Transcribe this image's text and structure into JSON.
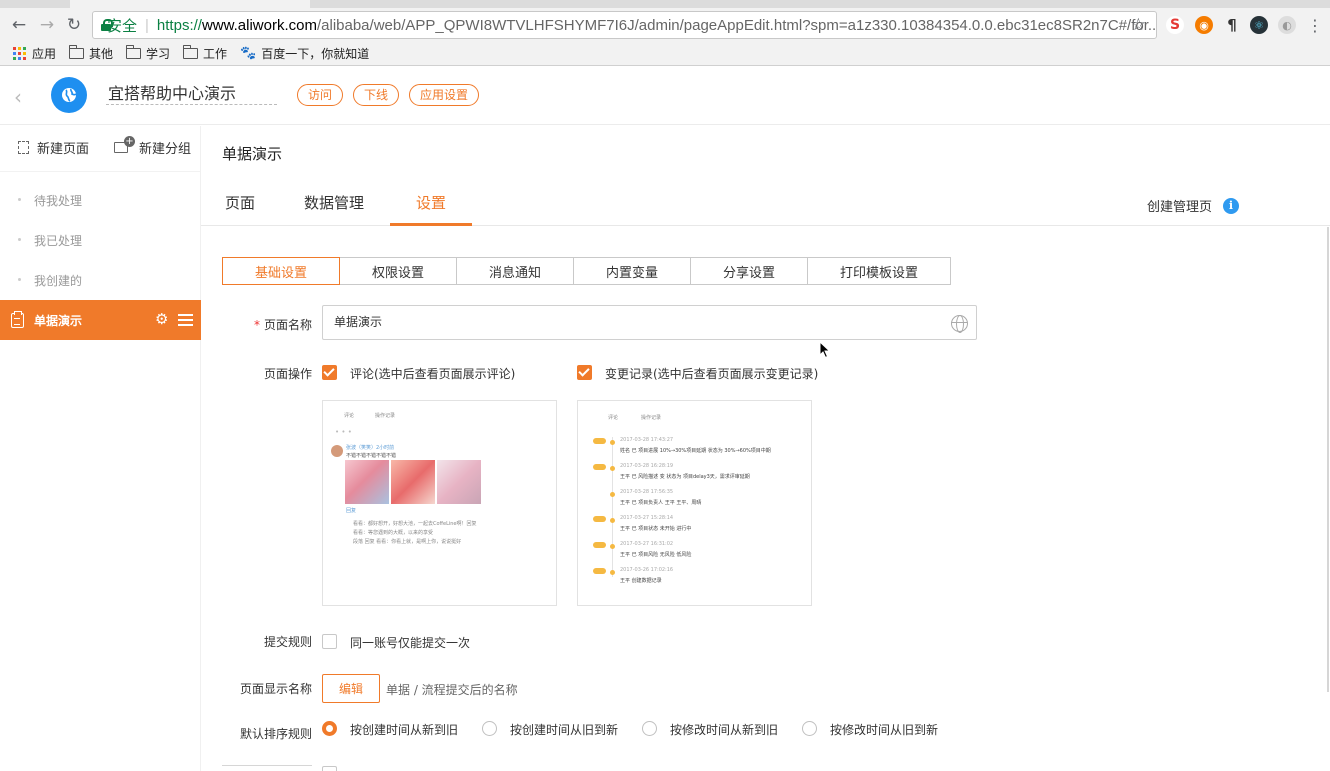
{
  "browser": {
    "secure_label": "安全",
    "url_proto": "https://",
    "url_host": "www.aliwork.com",
    "url_path": "/alibaba/web/APP_QPWI8WTVLHFSHYMF7I6J/admin/pageAppEdit.html?spm=a1z330.10384354.0.0.ebc31ec8SR2n7C#/for...",
    "bookmarks": [
      {
        "label": "应用",
        "icon": "apps-grid-icon"
      },
      {
        "label": "其他",
        "icon": "folder-icon"
      },
      {
        "label": "学习",
        "icon": "folder-icon"
      },
      {
        "label": "工作",
        "icon": "folder-icon"
      },
      {
        "label": "百度一下，你就知道",
        "icon": "baidu-paw-icon"
      }
    ]
  },
  "header": {
    "app_title": "宜搭帮助中心演示",
    "buttons": [
      "访问",
      "下线",
      "应用设置"
    ],
    "accent": "#f07a2a"
  },
  "sidebar": {
    "actions": [
      "新建页面",
      "新建分组"
    ],
    "items": [
      "待我处理",
      "我已处理",
      "我创建的"
    ],
    "active_item": "单据演示"
  },
  "main": {
    "page_heading": "单据演示",
    "tabs": [
      "页面",
      "数据管理",
      "设置"
    ],
    "active_tab": "设置",
    "create_mgmt": "创建管理页",
    "sub_tabs": [
      "基础设置",
      "权限设置",
      "消息通知",
      "内置变量",
      "分享设置",
      "打印模板设置"
    ],
    "active_sub_tab": "基础设置"
  },
  "form": {
    "page_name": {
      "label": "页面名称",
      "required": "*",
      "value": "单据演示"
    },
    "page_ops": {
      "label": "页面操作",
      "options": [
        {
          "text": "评论(选中后查看页面展示评论)",
          "checked": true
        },
        {
          "text": "变更记录(选中后查看页面展示变更记录)",
          "checked": true
        }
      ]
    },
    "preview_comment": {
      "tabs": [
        "评论",
        "操作记录"
      ],
      "user": "张波（笑笑）2小时前",
      "text": "不错不错不错不错不错",
      "reply_label": "回复",
      "lines": [
        "看看：都好想开，好想大池，一起去CoffeLine啊！回复",
        "看看：等您遇到的大概，以来的享受",
        "段落 回复 看看：你看上就，是啊上你，说说挺好"
      ]
    },
    "preview_log": {
      "tabs": [
        "评论",
        "操作记录"
      ],
      "entries": [
        {
          "time": "2017-03-28  17:43:27",
          "text": "姓名  已 项目进展  10%→30%项目延期  状态为  30%→60%项目中期"
        },
        {
          "time": "2017-03-28  16:28:19",
          "text": "王平  已 风险描述  变  状态为  项目delay3天，需求评审延期"
        },
        {
          "time": "2017-03-28  17:56:35",
          "text": "王平  已 项目负责人  王平  王平、周晴"
        },
        {
          "time": "2017-03-27  15:28:14",
          "text": "王平  已 项目状态  未开始  进行中"
        },
        {
          "time": "2017-03-27  16:31:02",
          "text": "王平  已 项目风险  无风险  低风险"
        },
        {
          "time": "2017-03-26  17:02:16",
          "text": "王平  创建数据记录"
        }
      ]
    },
    "submit_rule": {
      "label": "提交规则",
      "option": "同一账号仅能提交一次",
      "checked": false
    },
    "display_name": {
      "label": "页面显示名称",
      "button": "编辑",
      "hint": "单据 / 流程提交后的名称"
    },
    "sort_rule": {
      "label": "默认排序规则",
      "options": [
        "按创建时间从新到旧",
        "按创建时间从旧到新",
        "按修改时间从新到旧",
        "按修改时间从旧到新"
      ],
      "selected": 0
    }
  }
}
